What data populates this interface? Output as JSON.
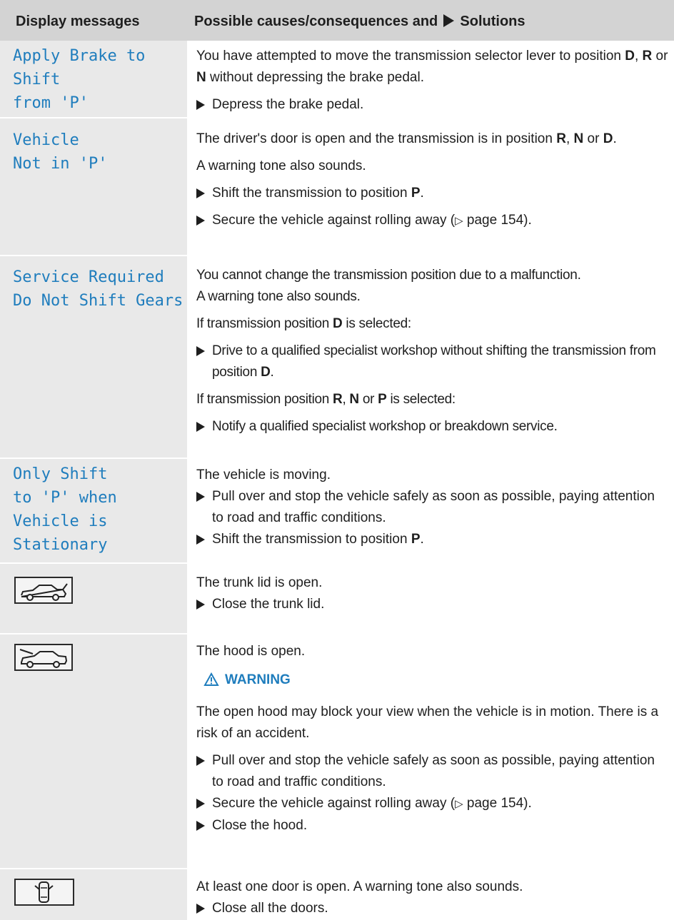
{
  "header": {
    "col1": "Display messages",
    "col2_prefix": "Possible causes/consequences and",
    "col2_suffix": "Solutions"
  },
  "rows": {
    "r1": {
      "msg": "Apply Brake to\nShift\nfrom 'P'",
      "p1": [
        "You have attempted to move the transmission selector lever to position ",
        "D",
        ", ",
        "R",
        " or ",
        "N",
        " without depressing the brake pedal."
      ],
      "b1": "Depress the brake pedal."
    },
    "r2": {
      "msg": "Vehicle\nNot in 'P'",
      "p1": [
        "The driver's door is open and the transmission is in position ",
        "R",
        ", ",
        "N",
        " or ",
        "D",
        "."
      ],
      "p2": "A warning tone also sounds.",
      "b1": [
        "Shift the transmission to position ",
        "P",
        "."
      ],
      "b2": [
        "Secure the vehicle against rolling away (",
        "▷",
        " page 154)."
      ]
    },
    "r3": {
      "msg": "Service Required\nDo Not Shift Gears",
      "p1": "You cannot change the transmission position due to a malfunction.",
      "p2": "A warning tone also sounds.",
      "p3": [
        "If transmission position ",
        "D",
        " is selected:"
      ],
      "b1": [
        "Drive to a qualified specialist workshop without shifting the transmission from position ",
        "D",
        "."
      ],
      "p4": [
        "If transmission position ",
        "R",
        ", ",
        "N",
        " or ",
        "P",
        " is selected:"
      ],
      "b2": "Notify a qualified specialist workshop or breakdown service."
    },
    "r4": {
      "msg": "Only Shift\nto 'P' when\nVehicle is\nStationary",
      "p1": "The vehicle is moving.",
      "b1": "Pull over and stop the vehicle safely as soon as possible, paying attention to road and traffic conditions.",
      "b2": [
        "Shift the transmission to position ",
        "P",
        "."
      ]
    },
    "r5": {
      "icon": "trunk-open-icon",
      "p1": "The trunk lid is open.",
      "b1": "Close the trunk lid."
    },
    "r6": {
      "icon": "hood-open-icon",
      "p1": "The hood is open.",
      "warning_label": "WARNING",
      "p2": "The open hood may block your view when the vehicle is in motion. There is a risk of an accident.",
      "b1": "Pull over and stop the vehicle safely as soon as possible, paying attention to road and traffic conditions.",
      "b2": [
        "Secure the vehicle against rolling away (",
        "▷",
        " page 154)."
      ],
      "b3": "Close the hood."
    },
    "r7": {
      "icon": "door-open-icon",
      "p1": "At least one door is open. A warning tone also sounds.",
      "b1": "Close all the doors."
    }
  },
  "colors": {
    "message_text": "#1f7dbd",
    "header_bg": "#d3d3d3",
    "left_col_bg": "#e9e9e9",
    "warning": "#1f7dbd"
  }
}
